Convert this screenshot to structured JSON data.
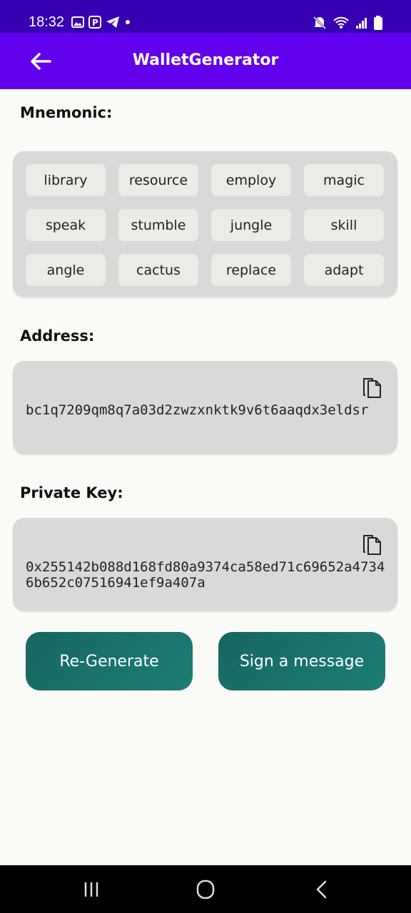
{
  "status_bar": {
    "time": "18:32",
    "left_icons": [
      "image-icon",
      "parking-icon",
      "telegram-icon",
      "dot-icon"
    ],
    "right_icons": [
      "mute-icon",
      "wifi-icon",
      "signal-icon",
      "battery-icon"
    ]
  },
  "app_bar": {
    "title": "WalletGenerator",
    "back_icon": "arrow-left-icon"
  },
  "mnemonic": {
    "label": "Mnemonic:",
    "words": [
      "library",
      "resource",
      "employ",
      "magic",
      "speak",
      "stumble",
      "jungle",
      "skill",
      "angle",
      "cactus",
      "replace",
      "adapt"
    ]
  },
  "address": {
    "label": "Address:",
    "value": "bc1q7209qm8q7a03d2zwzxnktk9v6t6aaqdx3eldsr",
    "copy_icon": "copy-icon"
  },
  "private_key": {
    "label": "Private Key:",
    "value": "0x255142b088d168fd80a9374ca58ed71c69652a47346b652c07516941ef9a407a",
    "copy_icon": "copy-icon"
  },
  "actions": {
    "regenerate_label": "Re-Generate",
    "sign_label": "Sign a message"
  },
  "nav_bar": {
    "icons": [
      "recent-apps-icon",
      "home-icon",
      "back-nav-icon"
    ]
  },
  "colors": {
    "status_bar": "#3700b3",
    "app_bar": "#6200ee",
    "button": "#1a7269",
    "card": "#dad9d7",
    "chip": "#ecebe7",
    "background": "#fafaf7"
  }
}
